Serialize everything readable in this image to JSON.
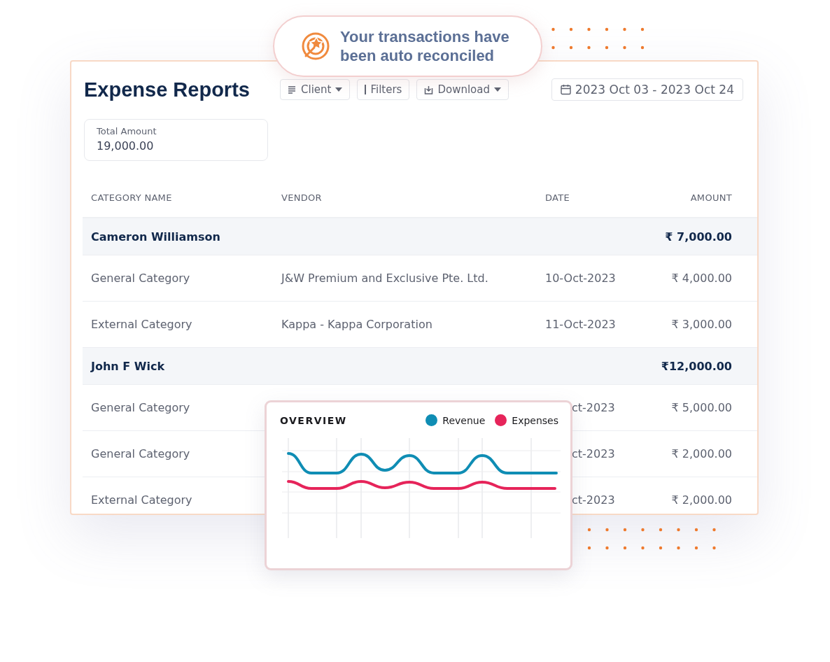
{
  "toast": {
    "message": "Your transactions have been auto reconciled"
  },
  "report": {
    "title": "Expense Reports",
    "toolbar": [
      {
        "label": "Client",
        "kind": "menu"
      },
      {
        "label": "Filters",
        "kind": "filter"
      },
      {
        "label": "Download",
        "kind": "download"
      }
    ],
    "date_range": "2023 Oct 03 - 2023 Oct 24",
    "total": {
      "label": "Total Amount",
      "value": "19,000.00"
    },
    "table": {
      "columns": [
        "CATEGORY NAME",
        "VENDOR",
        "DATE",
        "AMOUNT"
      ],
      "rows": [
        {
          "kind": "group",
          "name": "Cameron Williamson",
          "amount": "₹ 7,000.00"
        },
        {
          "kind": "item",
          "category": "General Category",
          "vendor": "J&W Premium and Exclusive Pte. Ltd.",
          "date": "10-Oct-2023",
          "amount": "₹ 4,000.00"
        },
        {
          "kind": "item",
          "category": "External Category",
          "vendor": "Kappa - Kappa Corporation",
          "date": "11-Oct-2023",
          "amount": "₹ 3,000.00"
        },
        {
          "kind": "group",
          "name": "John F Wick",
          "amount": "₹12,000.00"
        },
        {
          "kind": "item",
          "category": "General Category",
          "date": "ct-2023",
          "amount": "₹ 5,000.00"
        },
        {
          "kind": "item",
          "category": "General Category",
          "date": "ct-2023",
          "amount": "₹ 2,000.00"
        },
        {
          "kind": "item",
          "category": "External Category",
          "date": "ct-2023",
          "amount": "₹ 2,000.00"
        }
      ]
    }
  },
  "overview": {
    "title": "OVERVIEW",
    "legend": [
      {
        "label": "Revenue",
        "color": "#0f8db4"
      },
      {
        "label": "Expenses",
        "color": "#e6245a"
      }
    ]
  }
}
